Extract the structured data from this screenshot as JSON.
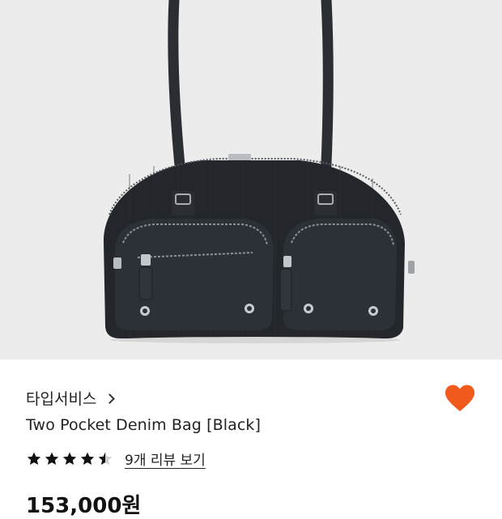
{
  "product": {
    "brand": "타입서비스",
    "title": "Two Pocket Denim Bag [Black]",
    "rating": 4.5,
    "rating_max": 5,
    "review_link": "9개 리뷰 보기",
    "price": "153,000원"
  },
  "icons": {
    "brand_chevron": "chevron-right-icon",
    "wishlist": "heart-icon",
    "rating_star": "star-icon"
  },
  "colors": {
    "wishlist_heart": "#f05a1a",
    "star": "#111111",
    "hero_background": "#ececec"
  }
}
